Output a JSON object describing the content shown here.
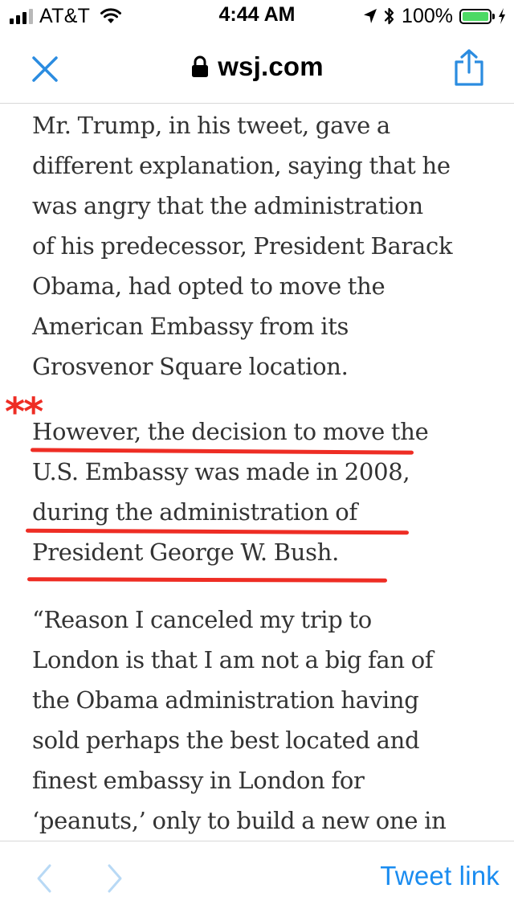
{
  "status_bar": {
    "carrier": "AT&T",
    "time": "4:44 AM",
    "battery_percent": "100%",
    "icons": [
      "signal-icon",
      "wifi-icon",
      "location-arrow-icon",
      "bluetooth-icon",
      "battery-icon",
      "charging-bolt-icon"
    ],
    "battery_level": 1.0
  },
  "nav": {
    "domain": "wsj.com",
    "icons": [
      "close-icon",
      "lock-icon",
      "share-icon"
    ],
    "accent": "#2b8ce0"
  },
  "article": {
    "paragraphs": [
      {
        "lines": [
          "Mr. Trump, in his tweet, gave a",
          "different explanation, saying that he",
          "was angry that the administration",
          "of his predecessor, President Barack",
          "Obama, had opted to move the",
          "American Embassy from its",
          "Grosvenor Square location."
        ]
      },
      {
        "lines": [
          "However, the decision to move the",
          "U.S. Embassy was made in 2008,",
          "during the administration of",
          "President George W. Bush."
        ]
      },
      {
        "lines": [
          "“Reason I canceled my trip to",
          "London is that I am not a big fan of",
          "the Obama administration having",
          "sold perhaps the best located and",
          "finest embassy in London for",
          "‘peanuts,’ only to build a new one in"
        ]
      }
    ],
    "annotation": {
      "asterisks": "**",
      "color": "#ee2d24"
    }
  },
  "toolbar": {
    "tweet_link_label": "Tweet link",
    "link_color": "#1a8cf0",
    "icons": [
      "chevron-left-icon",
      "chevron-right-icon"
    ]
  }
}
